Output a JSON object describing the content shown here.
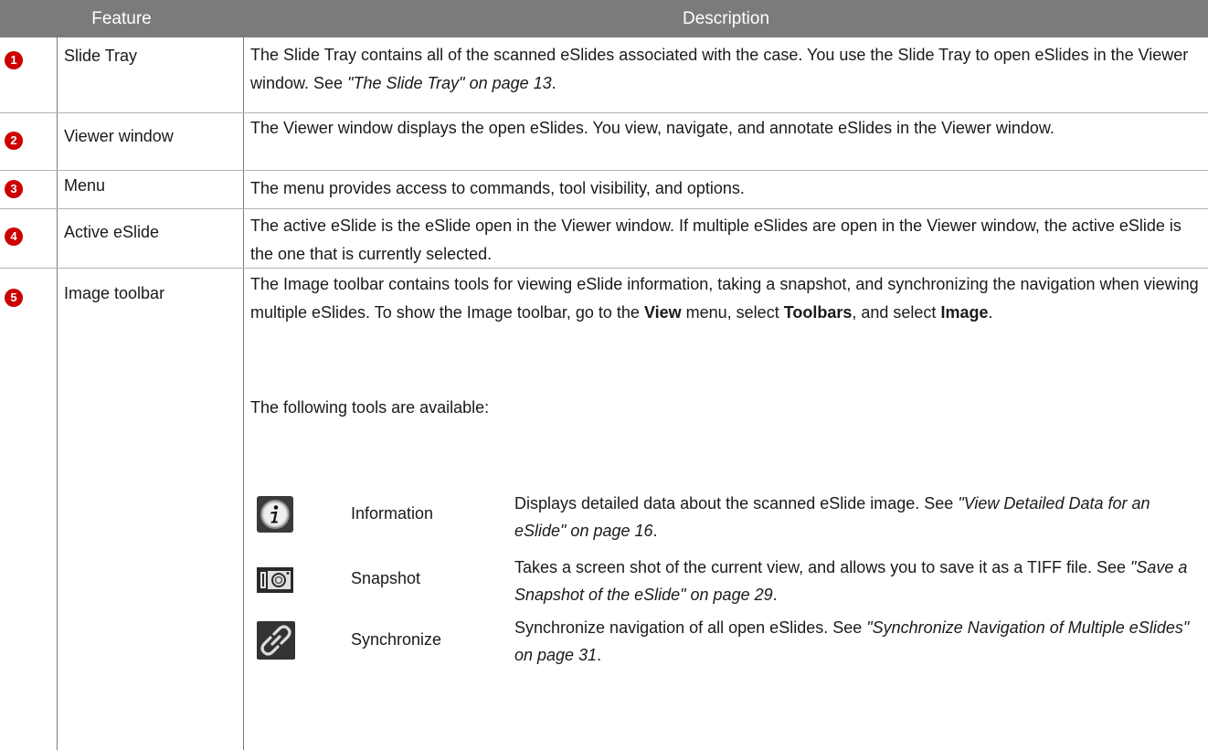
{
  "header": {
    "feature": "Feature",
    "description": "Description"
  },
  "rows": [
    {
      "num": "1",
      "feature": "Slide Tray",
      "desc_plain": "The Slide Tray contains all of the scanned eSlides associated with the case. You use the Slide Tray to open eSlides in the Viewer window. See ",
      "desc_ref": "\"The Slide Tray\" on page 13",
      "desc_end": "."
    },
    {
      "num": "2",
      "feature": "Viewer window",
      "desc": "The Viewer window displays the open eSlides. You view, navigate, and annotate eSlides in the Viewer window."
    },
    {
      "num": "3",
      "feature": "Menu",
      "desc": "The menu provides access to commands, tool visibility, and options."
    },
    {
      "num": "4",
      "feature": "Active eSlide",
      "desc": "The active eSlide is the eSlide open in the Viewer window. If multiple eSlides are open in the Viewer window, the active eSlide is the one that is currently selected."
    },
    {
      "num": "5",
      "feature": "Image toolbar",
      "desc_p1": "The Image toolbar contains tools for viewing eSlide information, taking a snapshot, and synchronizing the navigation when viewing multiple eSlides. To show the Image toolbar, go to the ",
      "desc_view": "View",
      "desc_mid1": " menu, select ",
      "desc_toolbars": "Toolbars",
      "desc_mid2": ", and select ",
      "desc_image": "Image",
      "desc_end": ".",
      "desc_p2": "The following tools are available:"
    }
  ],
  "tools": [
    {
      "icon": "information-icon",
      "name": "Information",
      "desc_plain": "Displays detailed data about the scanned eSlide image. See ",
      "desc_ref": "\"View Detailed Data for an eSlide\" on page 16",
      "desc_end": "."
    },
    {
      "icon": "camera-icon",
      "name": "Snapshot",
      "desc_plain": "Takes a screen shot of the current view, and allows you to save it as a TIFF file. See ",
      "desc_ref": "\"Save a Snapshot of the eSlide\" on page 29",
      "desc_end": "."
    },
    {
      "icon": "link-icon",
      "name": "Synchronize",
      "desc_plain": "Synchronize navigation of all open eSlides. See ",
      "desc_ref": "\"Synchronize Navigation of Multiple eSlides\" on page 31",
      "desc_end": "."
    }
  ],
  "colors": {
    "header_bg": "#7b7b7b",
    "badge": "#cc0000",
    "grid": "#b4b4b4"
  }
}
